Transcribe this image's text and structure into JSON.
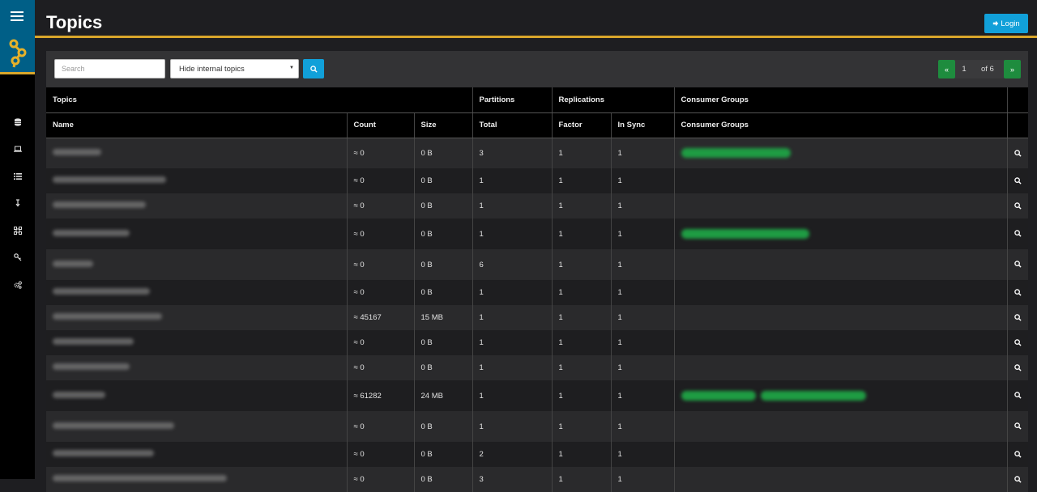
{
  "header": {
    "title": "Topics",
    "login_label": "Login"
  },
  "sidebar": {
    "icons": [
      "database-icon",
      "laptop-icon",
      "list-icon",
      "download-icon",
      "network-icon",
      "key-icon",
      "gears-icon"
    ]
  },
  "toolbar": {
    "search_placeholder": "Search",
    "filter_selected": "Hide internal topics"
  },
  "pagination": {
    "prev": "«",
    "current_page": "1",
    "of_label": "of 6",
    "next": "»"
  },
  "table": {
    "group_headers": {
      "topics": "Topics",
      "partitions": "Partitions",
      "replications": "Replications",
      "consumer_groups": "Consumer Groups"
    },
    "columns": {
      "name": "Name",
      "count": "Count",
      "size": "Size",
      "total": "Total",
      "factor": "Factor",
      "in_sync": "In Sync",
      "consumer_groups": "Consumer Groups"
    },
    "rows": [
      {
        "count": "≈ 0",
        "size": "0 B",
        "total": "3",
        "factor": "1",
        "in_sync": "1"
      },
      {
        "count": "≈ 0",
        "size": "0 B",
        "total": "1",
        "factor": "1",
        "in_sync": "1"
      },
      {
        "count": "≈ 0",
        "size": "0 B",
        "total": "1",
        "factor": "1",
        "in_sync": "1"
      },
      {
        "count": "≈ 0",
        "size": "0 B",
        "total": "1",
        "factor": "1",
        "in_sync": "1"
      },
      {
        "count": "≈ 0",
        "size": "0 B",
        "total": "6",
        "factor": "1",
        "in_sync": "1"
      },
      {
        "count": "≈ 0",
        "size": "0 B",
        "total": "1",
        "factor": "1",
        "in_sync": "1"
      },
      {
        "count": "≈ 45167",
        "size": "15 MB",
        "total": "1",
        "factor": "1",
        "in_sync": "1"
      },
      {
        "count": "≈ 0",
        "size": "0 B",
        "total": "1",
        "factor": "1",
        "in_sync": "1"
      },
      {
        "count": "≈ 0",
        "size": "0 B",
        "total": "1",
        "factor": "1",
        "in_sync": "1"
      },
      {
        "count": "≈ 61282",
        "size": "24 MB",
        "total": "1",
        "factor": "1",
        "in_sync": "1"
      },
      {
        "count": "≈ 0",
        "size": "0 B",
        "total": "1",
        "factor": "1",
        "in_sync": "1"
      },
      {
        "count": "≈ 0",
        "size": "0 B",
        "total": "2",
        "factor": "1",
        "in_sync": "1"
      },
      {
        "count": "≈ 0",
        "size": "0 B",
        "total": "3",
        "factor": "1",
        "in_sync": "1"
      }
    ]
  },
  "colors": {
    "accent": "#11a0d9",
    "brand_bar": "#d9a62b",
    "pager_green": "#1e8c3e",
    "sidebar_top": "#005f87"
  }
}
